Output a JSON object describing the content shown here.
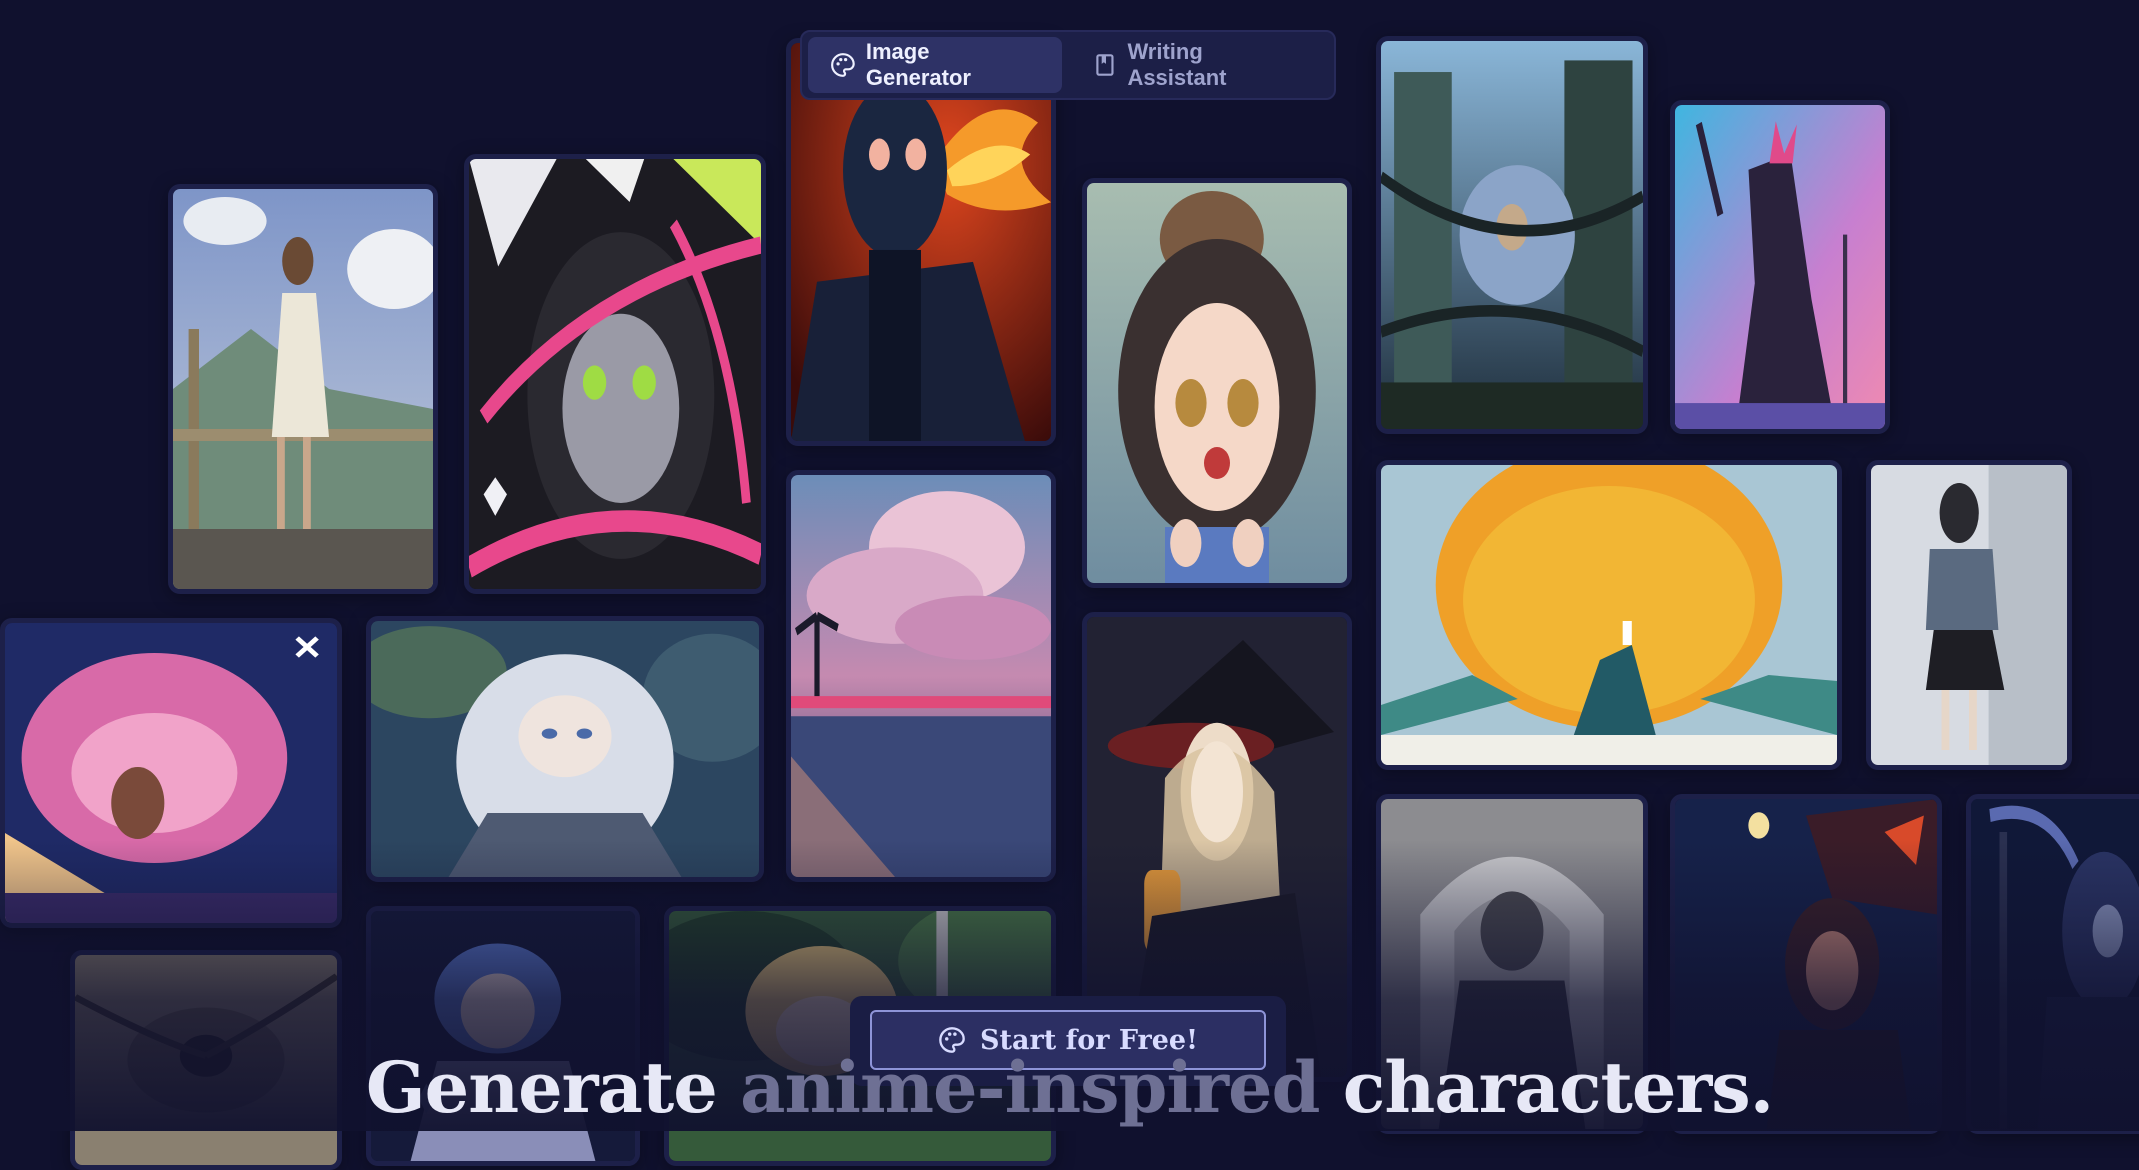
{
  "tabs": [
    {
      "label": "Image Generator",
      "icon": "palette-icon",
      "active": true
    },
    {
      "label": "Writing Assistant",
      "icon": "book-icon",
      "active": false
    }
  ],
  "cta": {
    "label": "Start for Free!",
    "icon": "palette-icon"
  },
  "headline": {
    "part1": "Generate ",
    "part2": "anime-inspired",
    "part3": " characters."
  },
  "colors": {
    "background": "#10112e",
    "panel": "#1c1f47",
    "active_tab": "#2e3266",
    "cta_border": "#8e94d8"
  },
  "gallery": [
    {
      "id": "boy-fence-sky"
    },
    {
      "id": "girl-pink-ribbons"
    },
    {
      "id": "masked-fire-figure"
    },
    {
      "id": "girl-bear-hat"
    },
    {
      "id": "ruined-tower-creature"
    },
    {
      "id": "dark-knight-pink-sky"
    },
    {
      "id": "beach-clouds-sunset"
    },
    {
      "id": "coral-pink"
    },
    {
      "id": "silver-hair-girl-blue"
    },
    {
      "id": "witch-lantern"
    },
    {
      "id": "orange-sun-cliff"
    },
    {
      "id": "schoolgirl-street"
    },
    {
      "id": "eye-fantasy"
    },
    {
      "id": "blue-hair-night"
    },
    {
      "id": "blonde-girl-forest"
    },
    {
      "id": "hooded-sketch"
    },
    {
      "id": "night-moon-girl"
    },
    {
      "id": "reaper-blue"
    }
  ]
}
